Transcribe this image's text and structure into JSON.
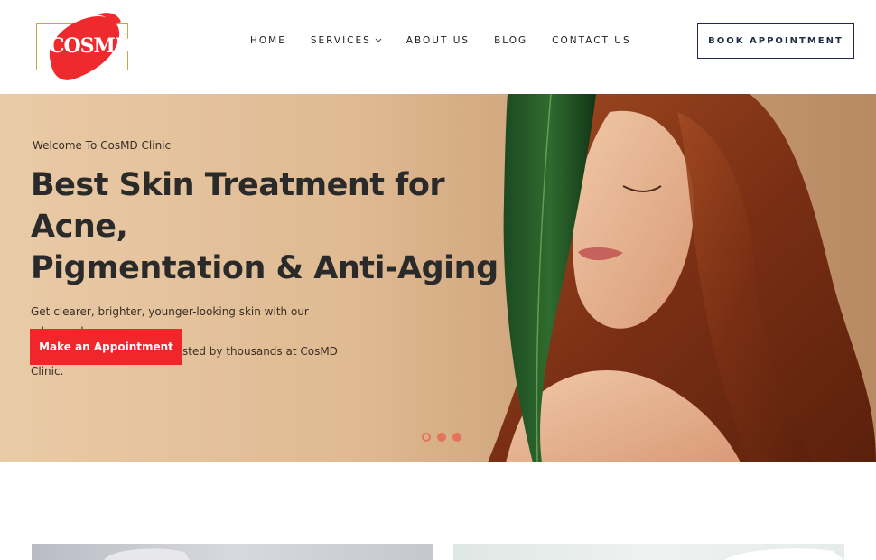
{
  "brand": {
    "logo_text": "COSMD",
    "accent": "#f0262b",
    "frame_color": "#c9a64a"
  },
  "nav": {
    "items": [
      {
        "label": "HOME"
      },
      {
        "label": "SERVICES",
        "has_dropdown": true
      },
      {
        "label": "ABOUT US"
      },
      {
        "label": "BLOG"
      },
      {
        "label": "CONTACT US"
      }
    ],
    "book_label": "BOOK APPOINTMENT"
  },
  "hero": {
    "welcome": "Welcome To CosMD Clinic",
    "headline_line1": "Best Skin Treatment for Acne,",
    "headline_line2": "Pigmentation & Anti-Aging",
    "subtext_line1": "Get clearer, brighter, younger-looking skin with our advanced",
    "subtext_line2": "cosmetology treatments trusted by thousands at CosMD Clinic.",
    "cta_label": "Make an Appointment",
    "slides": 3,
    "active_slide": 1
  },
  "icons": {
    "dropdown": "chevron-down-icon"
  }
}
